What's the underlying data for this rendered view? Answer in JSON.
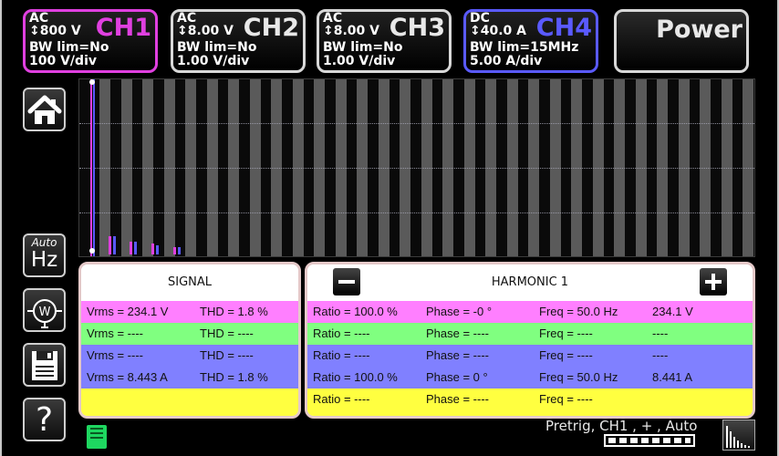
{
  "channels": [
    {
      "coupling": "AC",
      "range": "↕800 V",
      "bw": "BW lim=No",
      "scale": "100 V/div",
      "name": "CH1",
      "color": "#e040e0"
    },
    {
      "coupling": "AC",
      "range": "↕8.00 V",
      "bw": "BW lim=No",
      "scale": "1.00 V/div",
      "name": "CH2",
      "color": "#e8e8e8"
    },
    {
      "coupling": "AC",
      "range": "↕8.00 V",
      "bw": "BW lim=No",
      "scale": "1.00 V/div",
      "name": "CH3",
      "color": "#e8e8e8"
    },
    {
      "coupling": "DC",
      "range": "↕40.0 A",
      "bw": "BW lim=15MHz",
      "scale": "5.00 A/div",
      "name": "CH4",
      "color": "#5a5aff"
    }
  ],
  "power_label": "Power",
  "toolbar": {
    "home_icon": "home-icon",
    "auto_label": "Auto",
    "hz_label": "Hz",
    "watt_icon": "watt-icon",
    "memory_icon": "memory-card-icon",
    "help_icon": "help-icon"
  },
  "signal_table": {
    "header": "SIGNAL",
    "rows": [
      {
        "vrms": "Vrms = 234.1 V",
        "thd": "THD = 1.8 %"
      },
      {
        "vrms": "Vrms = ----",
        "thd": "THD = ----"
      },
      {
        "vrms": "Vrms = ----",
        "thd": "THD = ----"
      },
      {
        "vrms": "Vrms = 8.443 A",
        "thd": "THD = 1.8 %"
      },
      {
        "vrms": "",
        "thd": ""
      }
    ]
  },
  "harmonic_table": {
    "header": "HARMONIC 1",
    "minus_label": "−",
    "plus_label": "+",
    "rows": [
      {
        "ratio": "Ratio = 100.0 %",
        "phase": "Phase = -0 °",
        "freq": "Freq = 50.0 Hz",
        "val": "234.1 V"
      },
      {
        "ratio": "Ratio = ----",
        "phase": "Phase = ----",
        "freq": "Freq = ----",
        "val": "----"
      },
      {
        "ratio": "Ratio = ----",
        "phase": "Phase = ----",
        "freq": "Freq = ----",
        "val": "----"
      },
      {
        "ratio": "Ratio = 100.0 %",
        "phase": "Phase = 0 °",
        "freq": "Freq = 50.0 Hz",
        "val": "8.441 A"
      },
      {
        "ratio": "Ratio = ----",
        "phase": "Phase = ----",
        "freq": "Freq = ----",
        "val": ""
      }
    ]
  },
  "row_colors": [
    "#ff7fff",
    "#80ff80",
    "#8080ff",
    "#8080ff",
    "#ffff40"
  ],
  "status": {
    "trigger_text": "Pretrig, CH1 , + , Auto"
  }
}
